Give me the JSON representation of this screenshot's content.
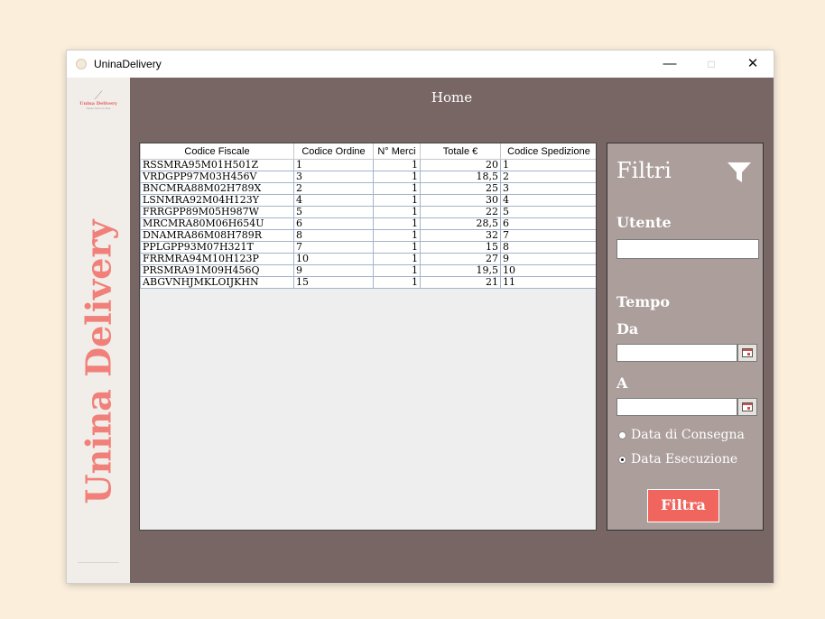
{
  "window": {
    "title": "UninaDelivery",
    "minimize_glyph": "—",
    "maximize_glyph": "□",
    "close_glyph": "✕"
  },
  "sidebar": {
    "logo_text": "Unina Delivery",
    "logo_subtitle": "Never come on time",
    "brand": "Unina Delivery"
  },
  "page": {
    "title": "Home"
  },
  "table": {
    "columns": [
      "Codice Fiscale",
      "Codice Ordine",
      "N° Merci",
      "Totale €",
      "Codice Spedizione"
    ],
    "rows": [
      [
        "RSSMRA95M01H501Z",
        "1",
        "1",
        "20",
        "1"
      ],
      [
        "VRDGPP97M03H456V",
        "3",
        "1",
        "18,5",
        "2"
      ],
      [
        "BNCMRA88M02H789X",
        "2",
        "1",
        "25",
        "3"
      ],
      [
        "LSNMRA92M04H123Y",
        "4",
        "1",
        "30",
        "4"
      ],
      [
        "FRRGPP89M05H987W",
        "5",
        "1",
        "22",
        "5"
      ],
      [
        "MRCMRA80M06H654U",
        "6",
        "1",
        "28,5",
        "6"
      ],
      [
        "DNAMRA86M08H789R",
        "8",
        "1",
        "32",
        "7"
      ],
      [
        "PPLGPP93M07H321T",
        "7",
        "1",
        "15",
        "8"
      ],
      [
        "FRRMRA94M10H123P",
        "10",
        "1",
        "27",
        "9"
      ],
      [
        "PRSMRA91M09H456Q",
        "9",
        "1",
        "19,5",
        "10"
      ],
      [
        "ABGVNHJMKLOIJKHN",
        "15",
        "1",
        "21",
        "11"
      ]
    ]
  },
  "filters": {
    "title": "Filtri",
    "icon": "funnel-icon",
    "utente_label": "Utente",
    "utente_value": "",
    "tempo_label": "Tempo",
    "da_label": "Da",
    "da_value": "",
    "a_label": "A",
    "a_value": "",
    "radio_consegna": "Data di Consegna",
    "radio_esecuzione": "Data Esecuzione",
    "selected_radio": "Data Esecuzione",
    "button_label": "Filtra"
  },
  "colors": {
    "desktop": "#fbeedb",
    "sidebar": "#f1ede8",
    "main": "#776664",
    "filter_panel": "#ab9e9b",
    "brand": "#f08079",
    "button": "#f0665e"
  }
}
